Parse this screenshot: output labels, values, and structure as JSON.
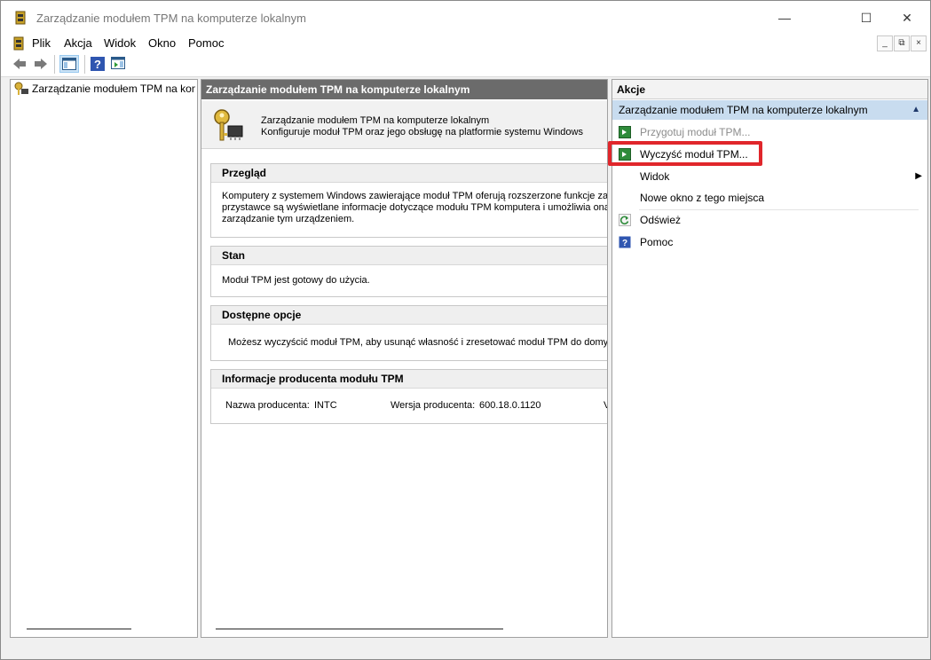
{
  "window": {
    "title": "Zarządzanie modułem TPM na komputerze lokalnym"
  },
  "menu": {
    "items": [
      "Plik",
      "Akcja",
      "Widok",
      "Okno",
      "Pomoc"
    ]
  },
  "tree": {
    "root_label": "Zarządzanie modułem TPM na kom"
  },
  "main": {
    "header": "Zarządzanie modułem TPM na komputerze lokalnym",
    "banner_line1": "Zarządzanie modułem TPM na komputerze lokalnym",
    "banner_line2": "Konfiguruje moduł TPM oraz jego obsługę na platformie systemu Windows",
    "sections": {
      "overview": {
        "title": "Przegląd",
        "line1": "Komputery z systemem Windows zawierające moduł TPM oferują rozszerzone funkcje zabez",
        "line2": "przystawce są wyświetlane informacje dotyczące modułu TPM komputera i umożliwia ona ac",
        "line3": "zarządzanie tym urządzeniem."
      },
      "status": {
        "title": "Stan",
        "text": "Moduł TPM jest gotowy do użycia."
      },
      "options": {
        "title": "Dostępne opcje",
        "text": "Możesz wyczyścić moduł TPM, aby usunąć własność i zresetować moduł TPM do domyśl"
      },
      "manufacturer": {
        "title": "Informacje producenta modułu TPM",
        "name_label": "Nazwa producenta:",
        "name_value": "INTC",
        "version_label": "Wersja producenta:",
        "version_value": "600.18.0.1120",
        "cut_text": "V"
      }
    }
  },
  "actions": {
    "header": "Akcje",
    "group": "Zarządzanie modułem TPM na komputerze lokalnym",
    "items": [
      {
        "label": "Przygotuj moduł TPM...",
        "icon": "green-arrow-icon",
        "enabled": false
      },
      {
        "label": "Wyczyść moduł TPM...",
        "icon": "green-arrow-icon",
        "enabled": true,
        "highlighted": true
      },
      {
        "label": "Widok",
        "icon": "",
        "submenu": true
      },
      {
        "label": "Nowe okno z tego miejsca",
        "icon": ""
      },
      {
        "label": "Odśwież",
        "icon": "refresh-icon"
      },
      {
        "label": "Pomoc",
        "icon": "help-icon"
      }
    ]
  },
  "colors": {
    "highlight": "#e0262b",
    "group_bg": "#c8dcef",
    "header_bg": "#6b6b6b"
  }
}
